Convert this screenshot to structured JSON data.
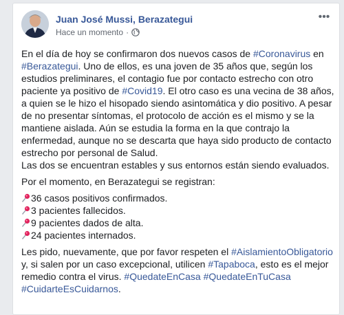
{
  "post": {
    "author": "Juan José Mussi, Berazategui",
    "timestamp": "Hace un momento",
    "separator": "·",
    "privacy_icon": "globe-icon",
    "more_icon": "ellipsis-icon",
    "more_label": "•••",
    "paragraph1": {
      "t1": "En el día de hoy se confirmaron dos nuevos casos de ",
      "tag1": "#Coronavirus",
      "t2": " en ",
      "tag2": "#Berazategui",
      "t3": ". Uno de ellos, es una joven de 35 años que, según los estudios preliminares, el contagio fue por contacto estrecho con otro paciente ya positivo de ",
      "tag3": "#Covid19",
      "t4": ". El otro caso es una vecina de 38 años, a quien se le hizo el hisopado siendo asintomática y dio positivo. A pesar de no presentar síntomas, el protocolo de acción es el mismo y se la mantiene aislada. Aún se estudia la forma en la que contrajo la enfermedad, aunque no se descarta que haya sido producto de contacto estrecho por personal de Salud."
    },
    "paragraph1b": "Las dos se encuentran estables y sus entornos están siendo evaluados.",
    "stats_intro": "Por el momento, en Berazategui se registran:",
    "stats": [
      "36 casos positivos confirmados.",
      "3 pacientes fallecidos.",
      "9 pacientes dados de alta.",
      "24 pacientes internados."
    ],
    "closing": {
      "t1": "Les pido, nuevamente, que por favor respeten el ",
      "tag1": "#AislamientoObligatorio",
      "t2": " y, si salen por un caso excepcional, utilicen ",
      "tag2": "#Tapaboca",
      "t3": ", esto es el mejor remedio contra el virus. ",
      "tag3": "#QuedateEnCasa",
      "sp1": " ",
      "tag4": "#QuedateEnTuCasa",
      "sp2": " ",
      "tag5": "#CuidarteEsCuidarnos",
      "t4": "."
    }
  },
  "colors": {
    "link": "#385898",
    "text": "#1c1e21",
    "meta": "#616770",
    "pin": "#e0245e"
  }
}
